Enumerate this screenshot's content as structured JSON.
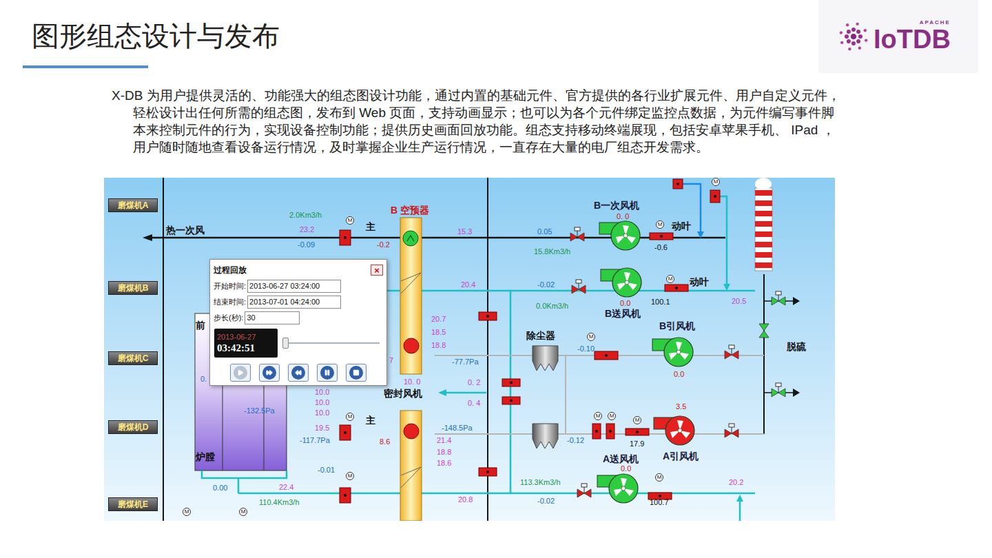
{
  "slide": {
    "title": "图形组态设计与发布",
    "paragraph": "X-DB 为用户提供灵活的、功能强大的组态图设计功能，通过内置的基础元件、官方提供的各行业扩展元件、用户自定义元件，轻松设计出任何所需的组态图，发布到 Web 页面，支持动画显示；也可以为各个元件绑定监控点数据，为元件编写事件脚本来控制元件的行为，实现设备控制功能；提供历史画面回放功能。组态支持移动终端展现，包括安卓苹果手机、 IPad ，用户随时随地查看设备运行情况，及时掌握企业生产运行情况，一直存在大量的电厂组态开发需求。"
  },
  "logo": {
    "small": "APACHE",
    "name": "IoTDB"
  },
  "diagram": {
    "mills": [
      "磨煤机A",
      "磨煤机B",
      "磨煤机C",
      "磨煤机D",
      "磨煤机E"
    ],
    "motor_mark": "M",
    "fans": [
      {
        "name": "B一次风机",
        "running": false
      },
      {
        "name": "B送风机",
        "running": false
      },
      {
        "name": "B引风机",
        "running": false
      },
      {
        "name": "A引风机",
        "running": true
      },
      {
        "name": "A送风机",
        "running": false
      }
    ],
    "labels": [
      {
        "text": "热一次风",
        "kind": "name",
        "color": "#111111"
      },
      {
        "text": "2.0Km3/h",
        "kind": "value",
        "color": "#17964a"
      },
      {
        "text": "23.2",
        "kind": "value",
        "color": "#cc3fcc"
      },
      {
        "text": "-0.09",
        "kind": "value",
        "color": "#1b6ec2"
      },
      {
        "text": "主",
        "kind": "name",
        "color": "#111111"
      },
      {
        "text": "-0.2",
        "kind": "value",
        "color": "#d01616"
      },
      {
        "text": "B 空预器",
        "kind": "name",
        "color": "#d01616"
      },
      {
        "text": "15.3",
        "kind": "value",
        "color": "#cc3fcc"
      },
      {
        "text": "0.05",
        "kind": "value",
        "color": "#1b6ec2"
      },
      {
        "text": "15.8Km3/h",
        "kind": "value",
        "color": "#17964a"
      },
      {
        "text": "0. 0",
        "kind": "value",
        "color": "#d01616"
      },
      {
        "text": "动叶",
        "kind": "name",
        "color": "#111111"
      },
      {
        "text": "-0.6",
        "kind": "value",
        "color": "#111111"
      },
      {
        "text": "20.4",
        "kind": "value",
        "color": "#cc3fcc"
      },
      {
        "text": "-0.02",
        "kind": "value",
        "color": "#1b6ec2"
      },
      {
        "text": "动叶",
        "kind": "name",
        "color": "#111111"
      },
      {
        "text": "0.0Km3/h",
        "kind": "value",
        "color": "#17964a"
      },
      {
        "text": "0.0",
        "kind": "value",
        "color": "#d01616"
      },
      {
        "text": "100.1",
        "kind": "value",
        "color": "#111111"
      },
      {
        "text": "20.5",
        "kind": "value",
        "color": "#cc3fcc"
      },
      {
        "text": "20.7",
        "kind": "value",
        "color": "#cc3fcc"
      },
      {
        "text": "18.5",
        "kind": "value",
        "color": "#cc3fcc"
      },
      {
        "text": "18.8",
        "kind": "value",
        "color": "#cc3fcc"
      },
      {
        "text": "除尘器",
        "kind": "name",
        "color": "#111111"
      },
      {
        "text": "-0.10",
        "kind": "value",
        "color": "#1b6ec2"
      },
      {
        "text": "0.0",
        "kind": "value",
        "color": "#d01616"
      },
      {
        "text": "脱硫",
        "kind": "name",
        "color": "#111111"
      },
      {
        "text": "-77.7Pa",
        "kind": "value",
        "color": "#1b6ec2"
      },
      {
        "text": "7",
        "kind": "value",
        "color": "#cc3fcc"
      },
      {
        "text": "10. 0",
        "kind": "value",
        "color": "#cc3fcc"
      },
      {
        "text": "0. 2",
        "kind": "value",
        "color": "#cc3fcc"
      },
      {
        "text": "10.0",
        "kind": "value",
        "color": "#cc3fcc"
      },
      {
        "text": "密封风机",
        "kind": "name",
        "color": "#111111"
      },
      {
        "text": "0. 4",
        "kind": "value",
        "color": "#cc3fcc"
      },
      {
        "text": "10.0",
        "kind": "value",
        "color": "#cc3fcc"
      },
      {
        "text": "10.0",
        "kind": "value",
        "color": "#cc3fcc"
      },
      {
        "text": "-132.5Pa",
        "kind": "value",
        "color": "#1b6ec2"
      },
      {
        "text": "主",
        "kind": "name",
        "color": "#111111"
      },
      {
        "text": "-148.5Pa",
        "kind": "value",
        "color": "#1b6ec2"
      },
      {
        "text": "19.5",
        "kind": "value",
        "color": "#cc3fcc"
      },
      {
        "text": "-117.7Pa",
        "kind": "value",
        "color": "#1b6ec2"
      },
      {
        "text": "8.6",
        "kind": "value",
        "color": "#d01616"
      },
      {
        "text": "21.4",
        "kind": "value",
        "color": "#cc3fcc"
      },
      {
        "text": "18.8",
        "kind": "value",
        "color": "#cc3fcc"
      },
      {
        "text": "18.6",
        "kind": "value",
        "color": "#cc3fcc"
      },
      {
        "text": "3.5",
        "kind": "value",
        "color": "#d01616"
      },
      {
        "text": "17.9",
        "kind": "value",
        "color": "#111111"
      },
      {
        "text": "-0.12",
        "kind": "value",
        "color": "#1b6ec2"
      },
      {
        "text": "0.0",
        "kind": "value",
        "color": "#d01616"
      },
      {
        "text": "-0.01",
        "kind": "value",
        "color": "#1b6ec2"
      },
      {
        "text": "炉膛",
        "kind": "name",
        "color": "#111111"
      },
      {
        "text": "前",
        "kind": "name",
        "color": "#111111"
      },
      {
        "text": "0.",
        "kind": "value",
        "color": "#1b6ec2"
      },
      {
        "text": "113.3Km3/h",
        "kind": "value",
        "color": "#17964a"
      },
      {
        "text": "20.2",
        "kind": "value",
        "color": "#cc3fcc"
      },
      {
        "text": "-0.02",
        "kind": "value",
        "color": "#1b6ec2"
      },
      {
        "text": "100.7",
        "kind": "value",
        "color": "#111111"
      },
      {
        "text": "0.00",
        "kind": "value",
        "color": "#1b6ec2"
      },
      {
        "text": "22.4",
        "kind": "value",
        "color": "#cc3fcc"
      },
      {
        "text": "110.4Km3/h",
        "kind": "value",
        "color": "#17964a"
      },
      {
        "text": "20.8",
        "kind": "value",
        "color": "#cc3fcc"
      }
    ],
    "playback": {
      "title": "过程回放",
      "close": "×",
      "fields": [
        {
          "label": "开始时间:",
          "value": "2013-06-27 03:24:00"
        },
        {
          "label": "结束时间:",
          "value": "2013-07-01 04:24:00"
        },
        {
          "label": "步长(秒):",
          "value": "30"
        }
      ],
      "clock_date": "2013-06-27",
      "clock_time": "03:42:51",
      "level": 0.02,
      "buttons": [
        {
          "kind": "play",
          "disabled": true
        },
        {
          "kind": "fast-forward",
          "disabled": false
        },
        {
          "kind": "rewind",
          "disabled": false
        },
        {
          "kind": "pause",
          "disabled": false
        },
        {
          "kind": "stop",
          "disabled": false
        }
      ]
    }
  }
}
